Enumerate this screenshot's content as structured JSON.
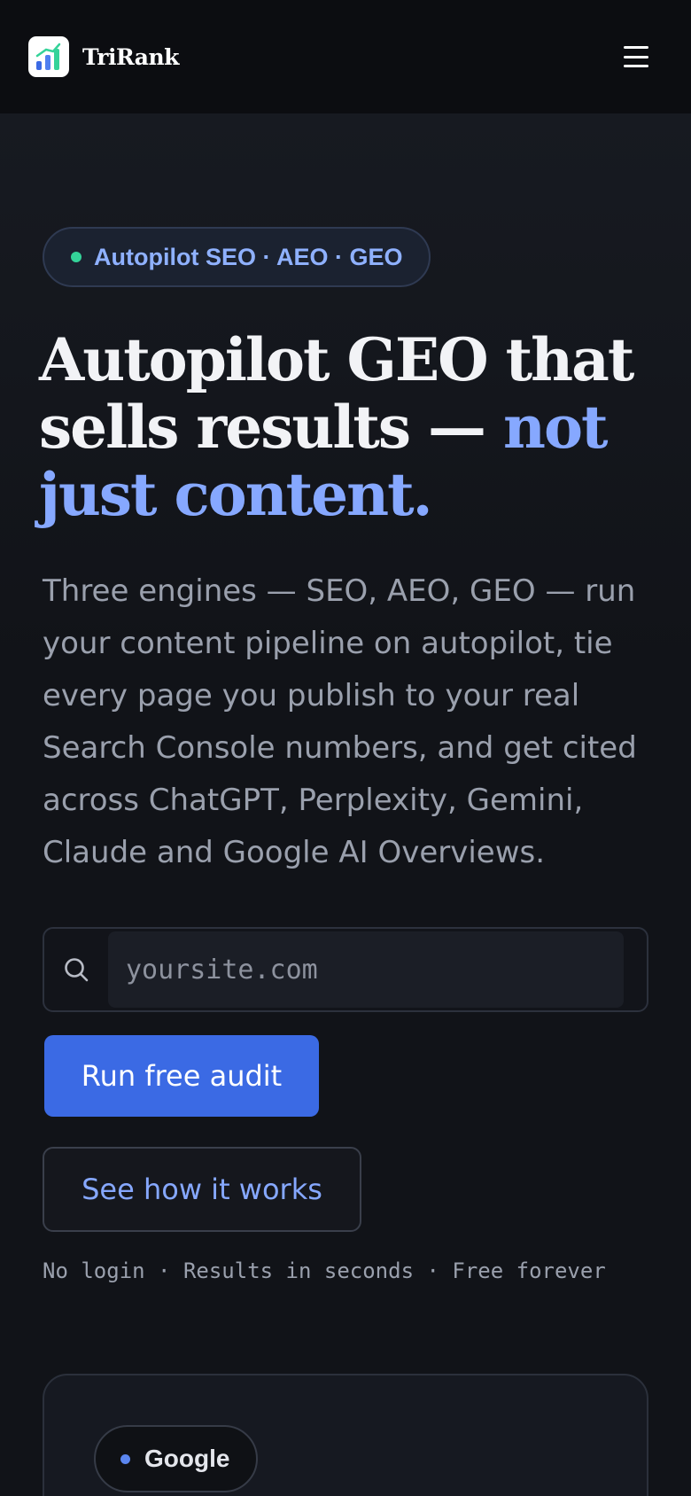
{
  "header": {
    "brand_name": "TriRank",
    "logo_icon": "bar-chart-logo-icon",
    "menu_icon": "hamburger-menu-icon"
  },
  "hero": {
    "badge": "Autopilot SEO · AEO · GEO",
    "headline_main": "Autopilot GEO that sells results — ",
    "headline_accent": "not just content.",
    "lead": "Three engines — SEO, AEO, GEO — run your content pipeline on autopilot, tie every page you publish to your real Search Console numbers, and get cited across ChatGPT, Perplexity, Gemini, Claude and Google AI Overviews.",
    "search_placeholder": "yoursite.com",
    "search_value": "",
    "primary_cta": "Run free audit",
    "secondary_cta": "See how it works",
    "fineprint": "No login · Results in seconds · Free forever"
  },
  "card": {
    "chip_label": "Google"
  },
  "colors": {
    "accent": "#86a8ff",
    "primary_button": "#3b6ae4",
    "status_dot": "#34d399",
    "background": "#111318"
  }
}
